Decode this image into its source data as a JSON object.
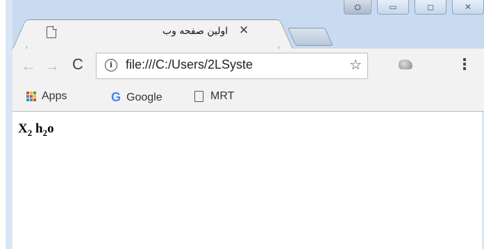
{
  "tab": {
    "title": "اولین صفحه وب",
    "close_glyph": "✕"
  },
  "toolbar": {
    "back_glyph": "←",
    "forward_glyph": "→",
    "reload_glyph": "C",
    "url": "file:///C:/Users/2LSyste",
    "info_glyph": "i",
    "star_glyph": "☆",
    "menu_glyph": "⋮"
  },
  "bookmarks": {
    "apps_label": "Apps",
    "google_label": "Google",
    "google_glyph": "G",
    "mrt_label": "MRT"
  },
  "page": {
    "x_text": "X",
    "x_sub": "2",
    "h_text": "h",
    "h_sub": "2",
    "o_text": "o"
  },
  "icons": {
    "apps_grid_colors": [
      "#ea4335",
      "#fbbc05",
      "#34a853",
      "#4285f4",
      "#ea4335",
      "#fbbc05",
      "#34a853",
      "#4285f4",
      "#ea4335"
    ]
  }
}
